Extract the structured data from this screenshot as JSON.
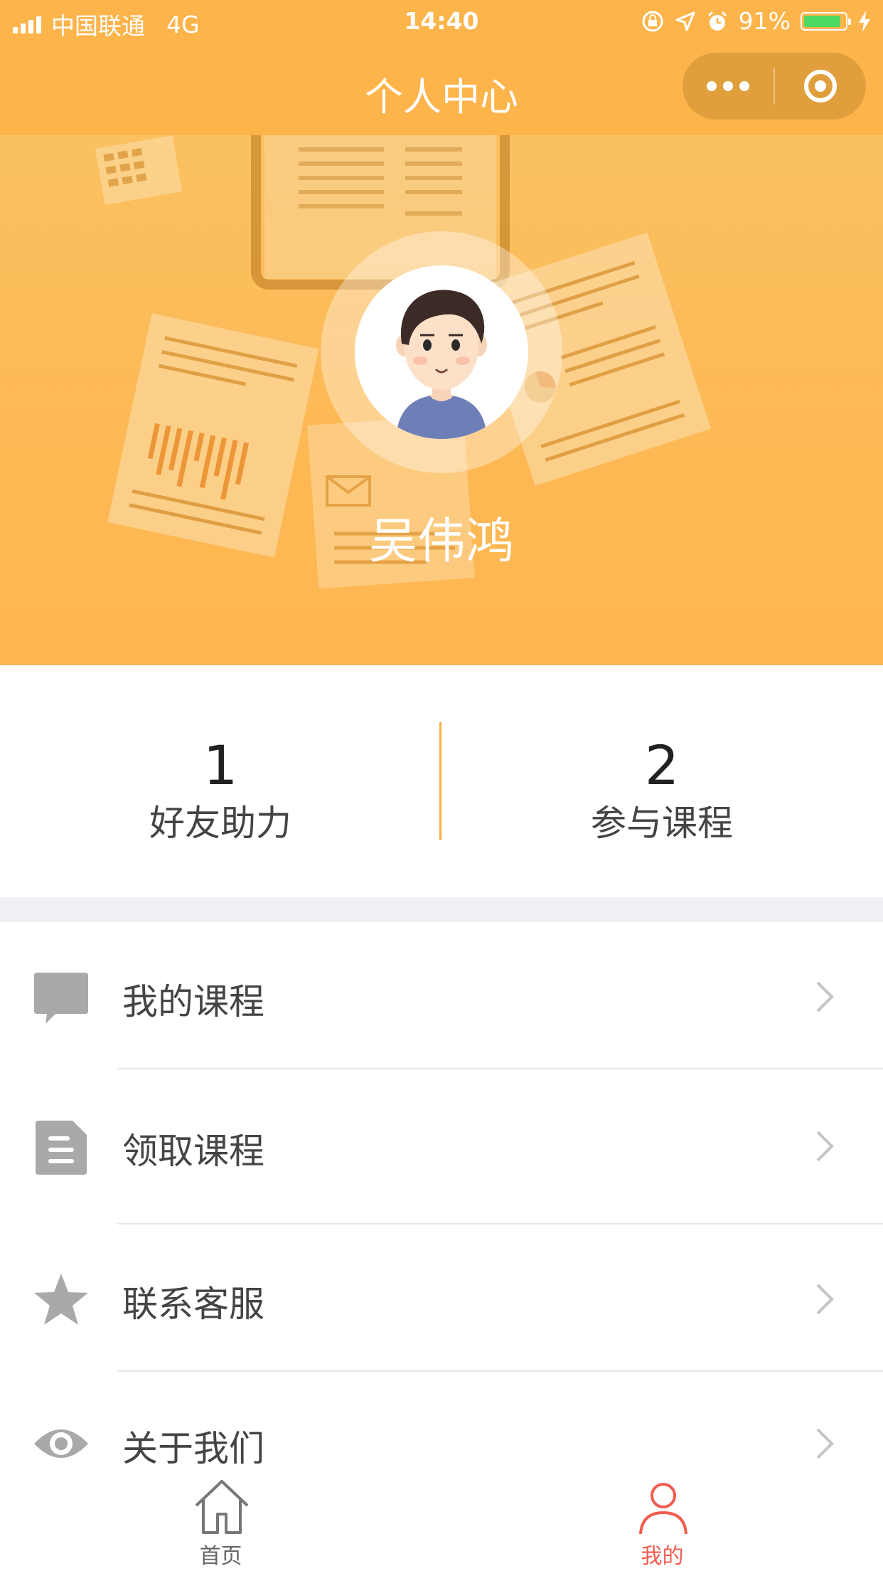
{
  "status_bar": {
    "carrier": "中国联通",
    "network": "4G",
    "time": "14:40",
    "battery": "91%",
    "battery_level": 0.91,
    "battery_color": "#4cd964"
  },
  "nav": {
    "title": "个人中心"
  },
  "profile": {
    "name": "吴伟鸿",
    "banner_color": "#fdb44b"
  },
  "stats": [
    {
      "value": "1",
      "label": "好友助力"
    },
    {
      "value": "2",
      "label": "参与课程"
    }
  ],
  "menu": {
    "items": [
      {
        "label": "我的课程",
        "icon": "chat-bubble-icon"
      },
      {
        "label": "领取课程",
        "icon": "document-icon"
      },
      {
        "label": "联系客服",
        "icon": "star-icon"
      },
      {
        "label": "关于我们",
        "icon": "eye-icon"
      }
    ]
  },
  "tab_bar": {
    "tabs": [
      {
        "label": "首页",
        "icon": "home-icon",
        "active": false
      },
      {
        "label": "我的",
        "icon": "user-icon",
        "active": true
      }
    ],
    "active_color": "#f35b4f",
    "inactive_color": "#666666"
  }
}
